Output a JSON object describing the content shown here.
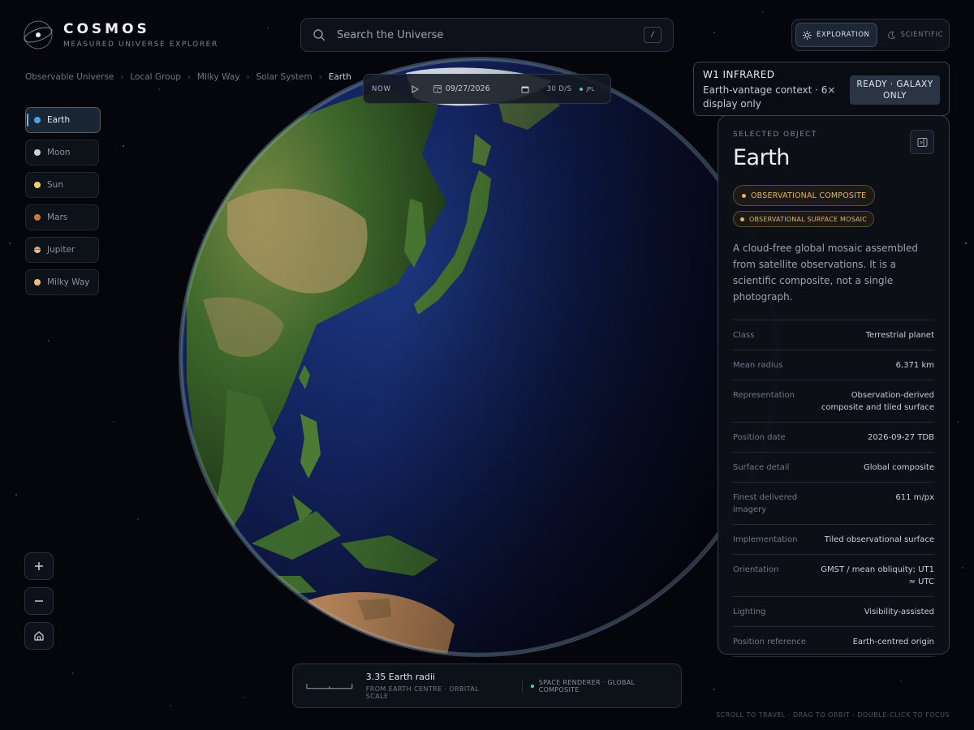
{
  "brand": {
    "title": "COSMOS",
    "subtitle": "MEASURED UNIVERSE EXPLORER"
  },
  "search": {
    "placeholder": "Search the Universe",
    "shortcut": "/"
  },
  "modes": [
    {
      "label": "EXPLORATION",
      "icon": "sun-icon",
      "active": true
    },
    {
      "label": "SCIENTIFIC",
      "icon": "moon-icon",
      "active": false
    }
  ],
  "breadcrumb": [
    "Observable Universe",
    "Local Group",
    "Milky Way",
    "Solar System",
    "Earth"
  ],
  "timebar": {
    "now_label": "NOW",
    "date": "09/27/2026",
    "rate": "30 D/S",
    "source": "JPL"
  },
  "w1": {
    "title": "W1 INFRARED",
    "description": "Earth-vantage context · 6× display only",
    "status": "READY · GALAXY ONLY"
  },
  "sidebar": {
    "items": [
      {
        "label": "Earth",
        "color": "#4aa3e0",
        "active": true
      },
      {
        "label": "Moon",
        "color": "#cfcfcf",
        "active": false
      },
      {
        "label": "Sun",
        "color": "#f3cf6e",
        "active": false
      },
      {
        "label": "Mars",
        "color": "#d66f4a",
        "active": false
      },
      {
        "label": "Jupiter",
        "color": "#d9a873",
        "active": false
      },
      {
        "label": "Milky Way",
        "color": "#f2c06a",
        "active": false
      }
    ]
  },
  "panel": {
    "label": "SELECTED OBJECT",
    "title": "Earth",
    "chips": [
      "OBSERVATIONAL COMPOSITE",
      "OBSERVATIONAL SURFACE MOSAIC"
    ],
    "description": "A cloud-free global mosaic assembled from satellite observations. It is a scientific composite, not a single photograph.",
    "properties": [
      {
        "key": "Class",
        "value": "Terrestrial planet"
      },
      {
        "key": "Mean radius",
        "value": "6,371 km"
      },
      {
        "key": "Representation",
        "value": "Observation-derived composite and tiled surface"
      },
      {
        "key": "Position date",
        "value": "2026-09-27 TDB"
      },
      {
        "key": "Surface detail",
        "value": "Global composite"
      },
      {
        "key": "Finest delivered imagery",
        "value": "611 m/px"
      },
      {
        "key": "Implementation",
        "value": "Tiled observational surface"
      },
      {
        "key": "Orientation",
        "value": "GMST / mean obliquity; UT1 ≈ UTC"
      },
      {
        "key": "Lighting",
        "value": "Visibility-assisted"
      },
      {
        "key": "Position reference",
        "value": "Earth-centred origin"
      }
    ]
  },
  "scale": {
    "main": "3.35 Earth radii",
    "sub": "FROM EARTH CENTRE · ORBITAL SCALE",
    "renderer": "SPACE RENDERER · GLOBAL COMPOSITE"
  },
  "hint": "SCROLL TO TRAVEL · DRAG TO ORBIT · DOUBLE-CLICK TO FOCUS",
  "colors": {
    "accent": "#56b8ef",
    "chip": "#e2b464",
    "live": "#4fd38c"
  }
}
